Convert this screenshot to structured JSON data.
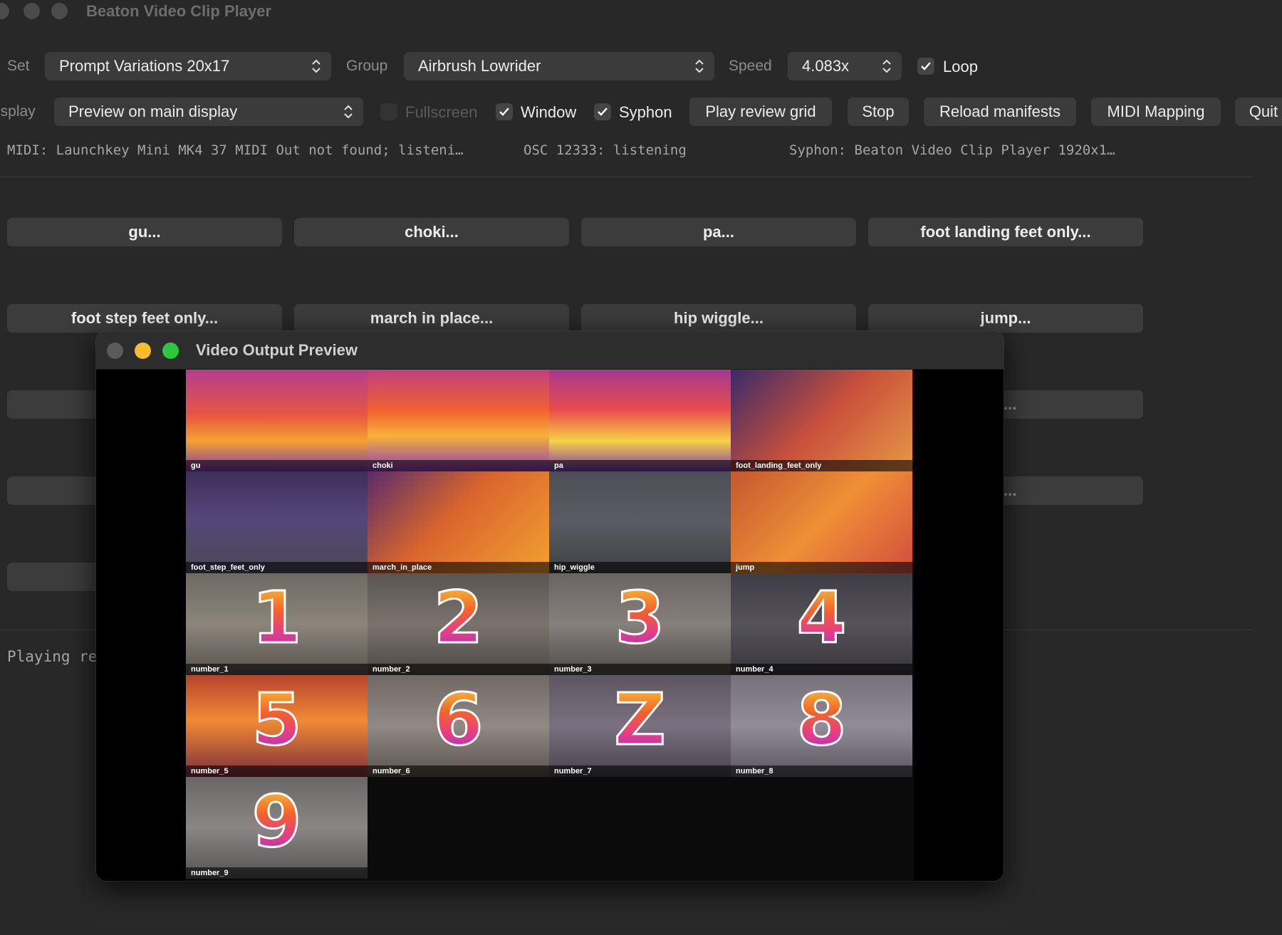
{
  "window": {
    "title": "Beaton Video Clip Player"
  },
  "controls": {
    "set_label": "Set",
    "set_value": "Prompt Variations 20x17",
    "group_label": "Group",
    "group_value": "Airbrush Lowrider",
    "speed_label": "Speed",
    "speed_value": "4.083x",
    "loop_label": "Loop",
    "loop_checked": true,
    "display_label": "isplay",
    "display_value": "Preview on main display",
    "fullscreen_label": "Fullscreen",
    "fullscreen_checked": false,
    "window_label": "Window",
    "window_checked": true,
    "syphon_label": "Syphon",
    "syphon_checked": true,
    "play_review_grid": "Play review grid",
    "stop": "Stop",
    "reload_manifests": "Reload manifests",
    "midi_mapping": "MIDI Mapping",
    "quit": "Quit"
  },
  "status": {
    "midi": "MIDI: Launchkey Mini MK4 37 MIDI Out not found; listeni…",
    "osc": "OSC 12333: listening",
    "syphon": "Syphon: Beaton Video Clip Player 1920x1…"
  },
  "clip_buttons": [
    "gu...",
    "choki...",
    "pa...",
    "foot landing feet only...",
    "foot step feet only...",
    "march in place...",
    "hip wiggle...",
    "jump...",
    "...",
    "..."
  ],
  "playing_text": "Playing re",
  "preview": {
    "title": "Video Output Preview",
    "tiles": [
      {
        "label": "gu"
      },
      {
        "label": "choki"
      },
      {
        "label": "pa"
      },
      {
        "label": "foot_landing_feet_only"
      },
      {
        "label": "foot_step_feet_only"
      },
      {
        "label": "march_in_place"
      },
      {
        "label": "hip_wiggle"
      },
      {
        "label": "jump"
      },
      {
        "label": "number_1",
        "numeral": "1"
      },
      {
        "label": "number_2",
        "numeral": "2"
      },
      {
        "label": "number_3",
        "numeral": "3"
      },
      {
        "label": "number_4",
        "numeral": "4"
      },
      {
        "label": "number_5",
        "numeral": "5"
      },
      {
        "label": "number_6",
        "numeral": "6"
      },
      {
        "label": "number_7",
        "numeral": "Z"
      },
      {
        "label": "number_8",
        "numeral": "8"
      },
      {
        "label": "number_9",
        "numeral": "9"
      }
    ]
  },
  "colors": {
    "window_bg": "#282828",
    "control_bg": "#3b3b3b",
    "traffic_red": "#5a5a5a",
    "traffic_yellow": "#f6be2f",
    "traffic_green": "#2bc840"
  }
}
